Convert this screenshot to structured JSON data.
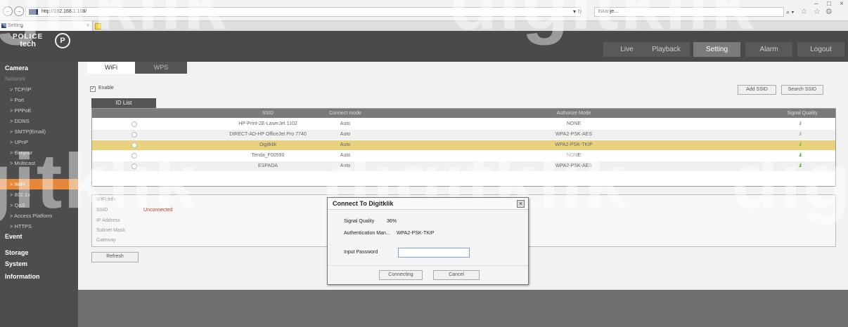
{
  "browser": {
    "back_icon": "back-arrow-icon",
    "forward_icon": "forward-arrow-icon",
    "back_glyph": "←",
    "forward_glyph": "→",
    "address": "http://192.168.1.108/",
    "refresh_icon": "refresh-icon",
    "refresh_glyph": "▾ ↻",
    "search_text": "Iskanje...",
    "search_glyph": "⌕ ▾",
    "home_glyph": "⌂",
    "star_glyph": "☆",
    "gear_glyph": "⚙",
    "minimize_glyph": "–",
    "maximize_glyph": "□",
    "close_glyph": "×",
    "tab_title": "Setting",
    "tab_close": "×"
  },
  "header": {
    "logo_line1": "POLICE",
    "logo_line2": "tech",
    "logo_mark": "P",
    "tabs": [
      {
        "label": "Live"
      },
      {
        "label": "Playback"
      },
      {
        "label": "Setting"
      },
      {
        "label": "Alarm"
      },
      {
        "label": "Logout"
      }
    ],
    "active_tab": "Setting",
    "accent_color": "#e6873a"
  },
  "sidebar": {
    "items": [
      {
        "label": "Camera",
        "type": "section"
      },
      {
        "label": "Network",
        "type": "section-open"
      },
      {
        "label": "> TCP/IP",
        "type": "sub"
      },
      {
        "label": "> Port",
        "type": "sub"
      },
      {
        "label": "> PPPoE",
        "type": "sub"
      },
      {
        "label": "> DDNS",
        "type": "sub"
      },
      {
        "label": "> SMTP(Email)",
        "type": "sub"
      },
      {
        "label": "> UPnP",
        "type": "sub"
      },
      {
        "label": "> Bonjour",
        "type": "sub"
      },
      {
        "label": "> Multicast",
        "type": "sub"
      },
      {
        "label": "> WiFi",
        "type": "sub-active"
      },
      {
        "label": "> 802.1x",
        "type": "sub"
      },
      {
        "label": "> QoS",
        "type": "sub"
      },
      {
        "label": "> Access Platform",
        "type": "sub"
      },
      {
        "label": "> HTTPS",
        "type": "sub"
      },
      {
        "label": "Event",
        "type": "section"
      },
      {
        "label": "Storage",
        "type": "section"
      },
      {
        "label": "System",
        "type": "section"
      },
      {
        "label": "Information",
        "type": "section"
      }
    ]
  },
  "main": {
    "tabs": [
      {
        "label": "WiFi"
      },
      {
        "label": "WPS"
      }
    ],
    "enable_label": "Enable",
    "enable_check": "✓",
    "add_ssid": "Add SSID",
    "search_ssid": "Search SSID",
    "list_tab": "ID List",
    "table": {
      "columns": [
        "SSID",
        "Connect mode",
        "Authorize Mode",
        "Signal Quality"
      ],
      "rows": [
        {
          "ssid": "HP-Print-2E-LaserJet 1102",
          "mode": "Auto",
          "auth": "NONE",
          "signal": ".ıl"
        },
        {
          "ssid": "DIRECT-AD-HP OfficeJet Pro 7740",
          "mode": "Auto",
          "auth": "WPA2-PSK-AES",
          "signal": ".ıl"
        },
        {
          "ssid": "Digitklik",
          "mode": "Auto",
          "auth": "WPA2-PSK-TKIP",
          "signal": ".ıl"
        },
        {
          "ssid": "Tenda_F00590",
          "mode": "Auto",
          "auth": "NONE",
          "signal": ".ıl"
        },
        {
          "ssid": "ESPADA",
          "mode": "Auto",
          "auth": "WPA2-PSK-AES",
          "signal": ".ıl"
        }
      ],
      "selected_row": 2
    },
    "wifi_info": {
      "title": "WiFi Info",
      "labels": [
        "SSID",
        "IP Address",
        "Subnet Mask",
        "Gateway"
      ],
      "status": "Unconnected",
      "status_color": "#c23b22"
    },
    "refresh": "Refresh"
  },
  "dialog": {
    "title": "Connect To Digitklik",
    "close_glyph": "×",
    "signal_label": "Signal Quality",
    "signal_value": "36%",
    "auth_label": "Authentication Man...",
    "auth_value": "WPA2-PSK-TKIP",
    "password_label": "Input Password",
    "password_value": "",
    "connect_button": "Connecting",
    "cancel_button": "Cancel"
  },
  "watermark": {
    "text1": "digitklik",
    "text2": "digitklik",
    "text3": "gitklik",
    "text4": "digitklik",
    "text5": "digitkli"
  }
}
